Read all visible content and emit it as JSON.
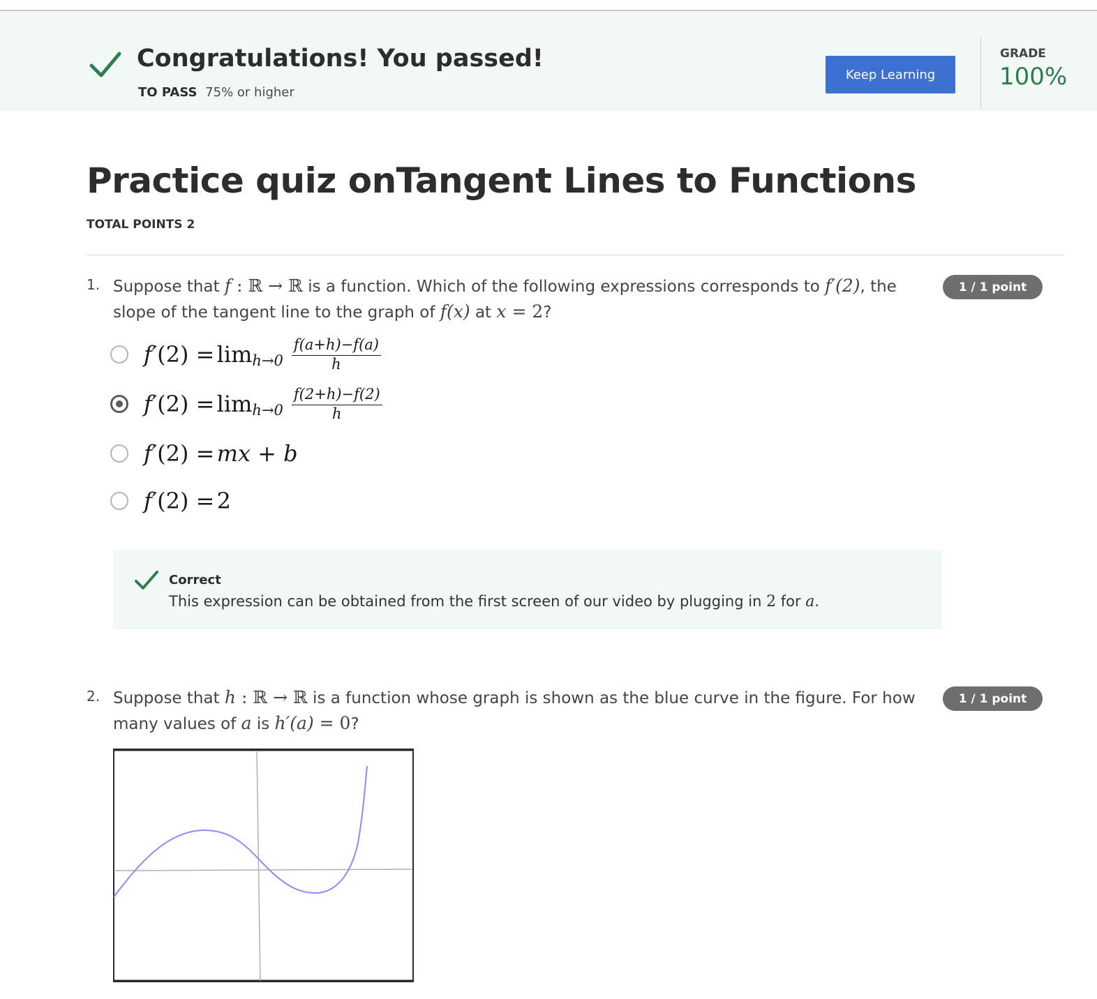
{
  "banner": {
    "title": "Congratulations! You passed!",
    "to_pass_label": "TO PASS",
    "to_pass_value": "75% or higher",
    "keep_learning": "Keep Learning",
    "grade_label": "GRADE",
    "grade_value": "100%"
  },
  "quiz": {
    "title": "Practice quiz onTangent Lines to Functions",
    "total_points": "TOTAL POINTS 2"
  },
  "questions": [
    {
      "number": "1.",
      "text": {
        "t1": "Suppose that ",
        "f": "f",
        "map": " : ℝ → ℝ",
        "t2": " is a function. Which of the following expressions corresponds to ",
        "fprime2": "f′(2)",
        "t3": ", the slope of the tangent line to the graph of ",
        "fx": "f(x)",
        "t4": " at ",
        "x": "x",
        "eq2": " = 2",
        "t5": "?"
      },
      "points": "1 / 1 point",
      "options": [
        {
          "lhs": "f′",
          "lhs_arg": "(2) = ",
          "lim": "lim",
          "lim_sub": "h→0",
          "num": "f(a+h)−f(a)",
          "den": "h",
          "selected": false
        },
        {
          "lhs": "f′",
          "lhs_arg": "(2) = ",
          "lim": "lim",
          "lim_sub": "h→0",
          "num": "f(2+h)−f(2)",
          "den": "h",
          "selected": true
        },
        {
          "lhs": "f′",
          "lhs_arg": "(2) = ",
          "rhs": "mx + b",
          "selected": false
        },
        {
          "lhs": "f′",
          "lhs_arg": "(2) = ",
          "rhs": "2",
          "selected": false
        }
      ],
      "feedback": {
        "title": "Correct",
        "t1": "This expression can be obtained from the first screen of our video by plugging in ",
        "two": "2",
        "t2": " for ",
        "a": "a",
        "t3": "."
      }
    },
    {
      "number": "2.",
      "text": {
        "t1": "Suppose that ",
        "h": "h",
        "map": " : ℝ → ℝ",
        "t2": " is a function whose graph is shown as the blue curve in the figure. For how many values of ",
        "a": "a",
        "t3": " is ",
        "hprime": "h′",
        "arg": "(a)",
        "eq0": " = 0",
        "t4": "?"
      },
      "points": "1 / 1 point"
    }
  ],
  "colors": {
    "accent_button": "#3c70d1",
    "success_green": "#2e7d4f",
    "curve_blue": "#8a8cf2",
    "banner_bg": "#f2f8f6"
  },
  "icons": {
    "banner": "check-icon",
    "feedback": "check-icon"
  }
}
